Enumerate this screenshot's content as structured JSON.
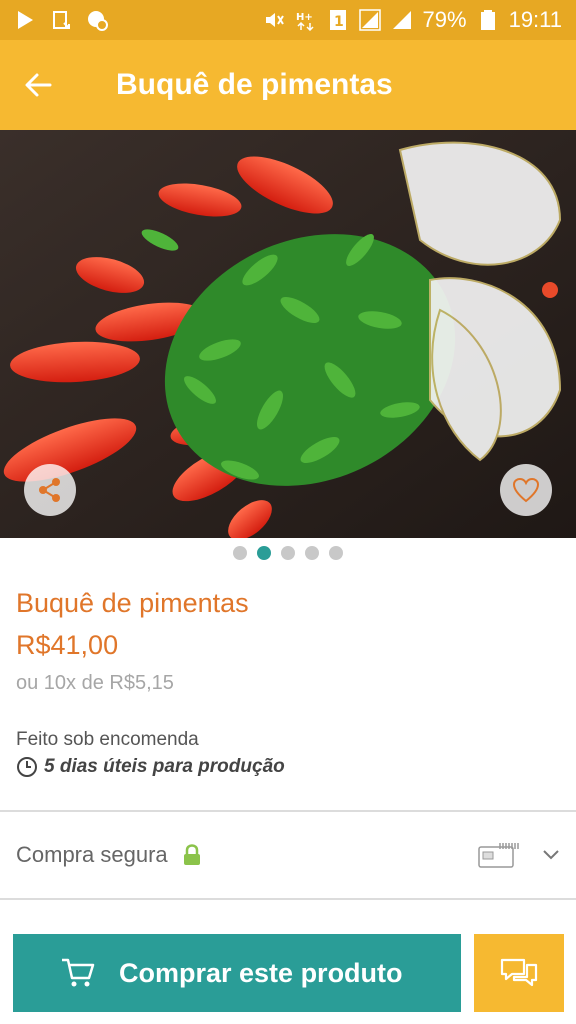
{
  "status_bar": {
    "battery": "79%",
    "time": "19:11",
    "left_icons": [
      "play-icon",
      "download-icon",
      "messenger-icon"
    ],
    "right_icons": [
      "mute-icon",
      "hplus-icon",
      "sim-icon",
      "signal-icon",
      "signal-icon",
      "battery-icon"
    ]
  },
  "app_bar": {
    "title": "Buquê de pimentas"
  },
  "gallery": {
    "page_count": 5,
    "active_index": 1
  },
  "product": {
    "name": "Buquê de pimentas",
    "price": "R$41,00",
    "installments": "ou 10x de R$5,15",
    "made_to_order": "Feito sob encomenda",
    "production_time": "5 dias úteis para produção"
  },
  "secure": {
    "label": "Compra segura"
  },
  "actions": {
    "buy_label": "Comprar este produto"
  },
  "colors": {
    "status_bar": "#e7a823",
    "app_bar": "#f6b931",
    "accent_teal": "#2a9d97",
    "price_orange": "#e0762a",
    "lock_green": "#8bc34a"
  }
}
